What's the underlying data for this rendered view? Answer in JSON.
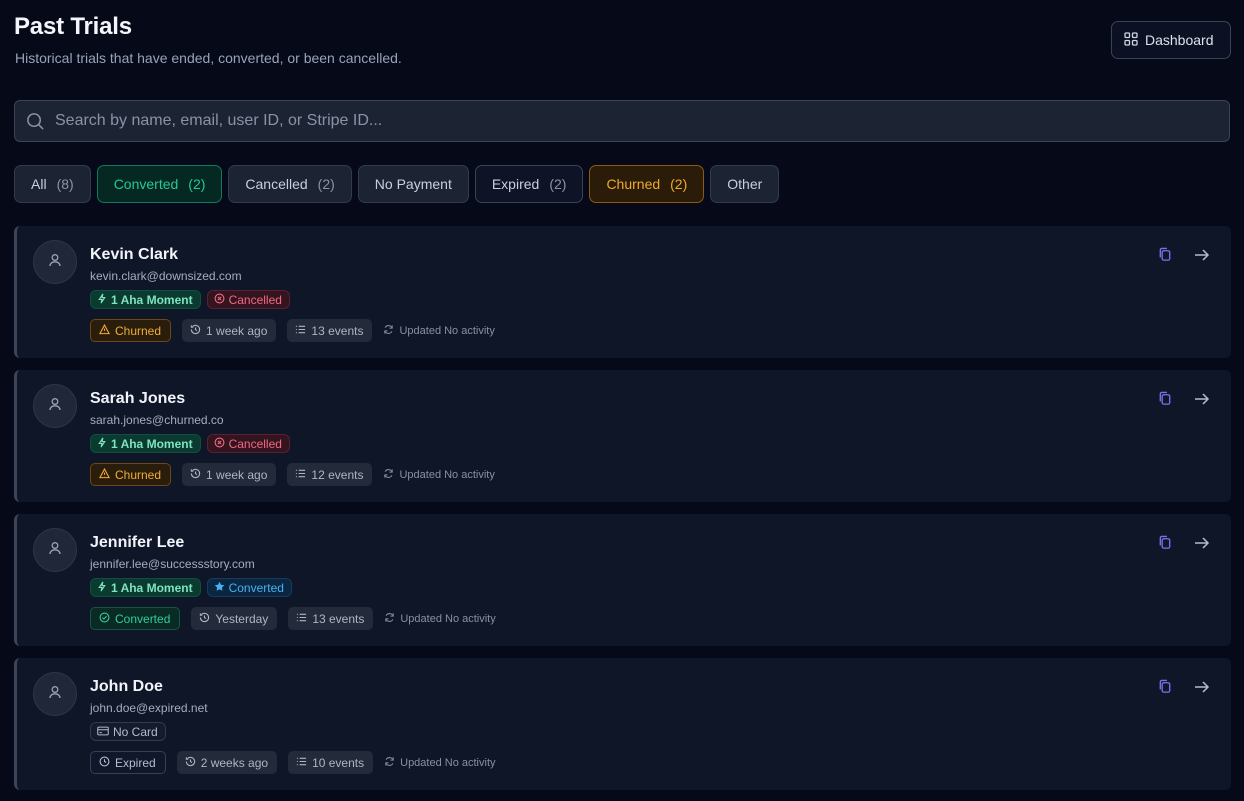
{
  "header": {
    "title": "Past Trials",
    "subtitle": "Historical trials that have ended, converted, or been cancelled.",
    "dashboard_label": "Dashboard"
  },
  "search": {
    "placeholder": "Search by name, email, user ID, or Stripe ID...",
    "value": ""
  },
  "filters": [
    {
      "label": "All",
      "count": "(8)"
    },
    {
      "label": "Converted",
      "count": "(2)"
    },
    {
      "label": "Cancelled",
      "count": "(2)"
    },
    {
      "label": "No Payment",
      "count": ""
    },
    {
      "label": "Expired",
      "count": "(2)"
    },
    {
      "label": "Churned",
      "count": "(2)"
    },
    {
      "label": "Other",
      "count": ""
    }
  ],
  "trials": [
    {
      "name": "Kevin Clark",
      "email": "kevin.clark@downsized.com",
      "aha": "1 Aha Moment",
      "payment_badge": "Cancelled",
      "status": "Churned",
      "time": "1 week ago",
      "events": "13 events",
      "updated": "Updated No activity"
    },
    {
      "name": "Sarah Jones",
      "email": "sarah.jones@churned.co",
      "aha": "1 Aha Moment",
      "payment_badge": "Cancelled",
      "status": "Churned",
      "time": "1 week ago",
      "events": "12 events",
      "updated": "Updated No activity"
    },
    {
      "name": "Jennifer Lee",
      "email": "jennifer.lee@successstory.com",
      "aha": "1 Aha Moment",
      "payment_badge": "Converted",
      "status": "Converted",
      "time": "Yesterday",
      "events": "13 events",
      "updated": "Updated No activity"
    },
    {
      "name": "John Doe",
      "email": "john.doe@expired.net",
      "payment_badge": "No Card",
      "status": "Expired",
      "time": "2 weeks ago",
      "events": "10 events",
      "updated": "Updated No activity"
    }
  ],
  "icons": {
    "dashboard": "grid-icon",
    "search": "search-icon",
    "avatar": "user-icon",
    "aha": "bolt-icon",
    "cancelled": "x-circle-icon",
    "converted_badge": "star-icon",
    "no_card": "credit-card-icon",
    "churned": "warning-icon",
    "converted": "check-circle-icon",
    "expired": "clock-icon",
    "time": "history-icon",
    "events": "list-icon",
    "updated": "refresh-icon",
    "copy": "copy-icon",
    "open": "arrow-right-icon"
  },
  "colors": {
    "background": "#060a18",
    "card": "#0f1628",
    "converted": "#23c993",
    "churned": "#f0a92a",
    "cancelled": "#f06a82",
    "info": "#46b2f3",
    "copy_icon": "#7b74f0"
  }
}
